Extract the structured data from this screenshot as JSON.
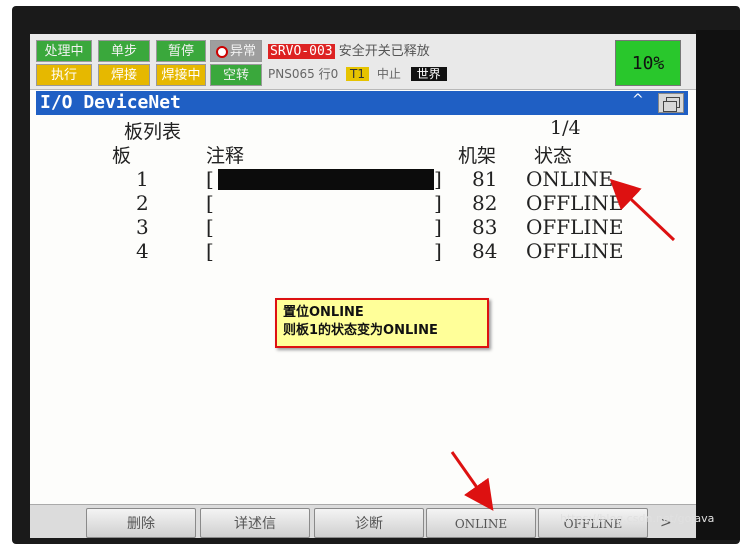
{
  "status": {
    "buttons": [
      "处理中",
      "单步",
      "暂停",
      "异常",
      "执行",
      "焊接",
      "焊接中",
      "空转"
    ],
    "alarm_code": "SRVO-003",
    "alarm_message": "安全开关已释放",
    "program": "PNS065",
    "line": "行0",
    "mode": "T1",
    "state": "中止",
    "coord_frame": "世界",
    "override": "10%"
  },
  "window": {
    "title": "I/O DeviceNet",
    "caret": "^"
  },
  "table": {
    "heading": "板列表",
    "page": "1/4",
    "col_board": "板",
    "col_comment": "注释",
    "col_rack": "机架",
    "col_status": "状态",
    "rows": [
      {
        "board": "1",
        "rack": "81",
        "status": "ONLINE"
      },
      {
        "board": "2",
        "rack": "82",
        "status": "OFFLINE"
      },
      {
        "board": "3",
        "rack": "83",
        "status": "OFFLINE"
      },
      {
        "board": "4",
        "rack": "84",
        "status": "OFFLINE"
      }
    ]
  },
  "callout": {
    "line1": "置位ONLINE",
    "line2": "则板1的状态变为ONLINE"
  },
  "softkeys": [
    "删除",
    "详述信",
    "诊断",
    "ONLINE",
    "OFFLINE"
  ],
  "softkey_next": ">",
  "watermark": "https://blog.csdn.net/gojava",
  "colors": {
    "titlebar": "#1f5fc4",
    "override": "#29c72c",
    "arrow": "#dd1111"
  }
}
